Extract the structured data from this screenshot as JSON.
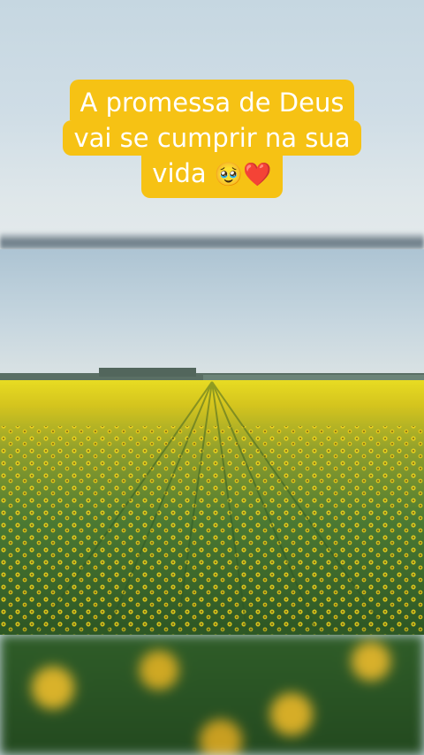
{
  "caption": {
    "line1": "A promessa de Deus",
    "line2": "vai se cumprir na sua",
    "line3_text": "vida",
    "emojis": "🥹❤️"
  },
  "colors": {
    "caption_bg": "#f6c214",
    "caption_text": "#ffffff",
    "sky": "#c6d7e1",
    "sunflower": "#e7da23",
    "foliage": "#3d6a2e"
  },
  "scene": "sunflower field"
}
